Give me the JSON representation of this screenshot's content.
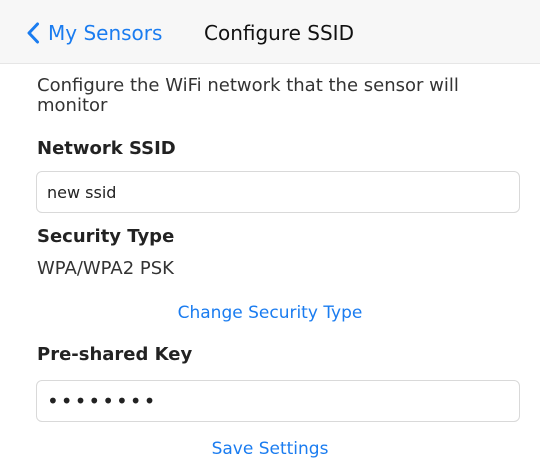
{
  "nav": {
    "back_label": "My Sensors",
    "title": "Configure SSID",
    "back_icon": "chevron-left-icon",
    "accent_color": "#1a7cf0"
  },
  "form": {
    "description": "Configure the WiFi network that the sensor will monitor",
    "ssid_label": "Network SSID",
    "ssid_value": "new ssid",
    "security_label": "Security Type",
    "security_value": "WPA/WPA2 PSK",
    "change_security_link": "Change Security Type",
    "psk_label": "Pre-shared Key",
    "psk_value": "••••••••",
    "save_link": "Save Settings"
  }
}
